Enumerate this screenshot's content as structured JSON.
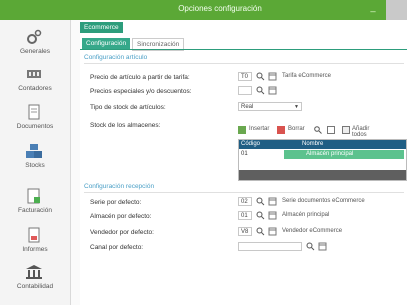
{
  "window": {
    "title": "Opciones configuración",
    "minimize_label": "_"
  },
  "sidebar": {
    "items": [
      {
        "label": "Generales",
        "icon": "gears-icon"
      },
      {
        "label": "Contadores",
        "icon": "counter-icon"
      },
      {
        "label": "Documentos",
        "icon": "documents-icon"
      },
      {
        "label": "Stocks",
        "icon": "boxes-icon"
      },
      {
        "label": "Facturación",
        "icon": "invoice-icon"
      },
      {
        "label": "Informes",
        "icon": "report-icon"
      },
      {
        "label": "Contabilidad",
        "icon": "bank-icon"
      }
    ]
  },
  "module": {
    "label": "Ecommerce"
  },
  "tabs": [
    {
      "label": "Configuración",
      "active": true
    },
    {
      "label": "Sincronización",
      "active": false
    }
  ],
  "section_articles": {
    "title": "Configuración artículo",
    "fields": {
      "price_label": "Precio de artículo a partir de tarifa:",
      "price_value": "T0",
      "price_desc": "Tarifa eCommerce",
      "special_label": "Precios especiales y/o descuentos:",
      "special_value": "",
      "stock_type_label": "Tipo de stock de artículos:",
      "stock_type_value": "Real",
      "warehouses_label": "Stock de los almacenes:"
    },
    "grid_toolbar": {
      "insert": "Insertar",
      "delete": "Borrar",
      "add_all": "Añadir todos"
    },
    "grid": {
      "columns": [
        "Código",
        "Nombre"
      ],
      "rows": [
        {
          "code": "01",
          "name": "Almacén principal"
        }
      ]
    }
  },
  "section_reception": {
    "title": "Configuración recepción",
    "fields": {
      "series_label": "Serie por defecto:",
      "series_value": "02",
      "series_desc": "Serie documentos eCommerce",
      "warehouse_label": "Almacén por defecto:",
      "warehouse_value": "01",
      "warehouse_desc": "Almacén principal",
      "seller_label": "Vendedor por defecto:",
      "seller_value": "V8",
      "seller_desc": "Vendedor eCommerce",
      "channel_label": "Canal por defecto:",
      "channel_value": ""
    }
  },
  "colors": {
    "titlebar": "#5ba836",
    "module_header": "#2d9d7c",
    "grid_header": "#1f5e84",
    "grid_selected": "#5cc28e",
    "section_title": "#4a9fc6"
  }
}
